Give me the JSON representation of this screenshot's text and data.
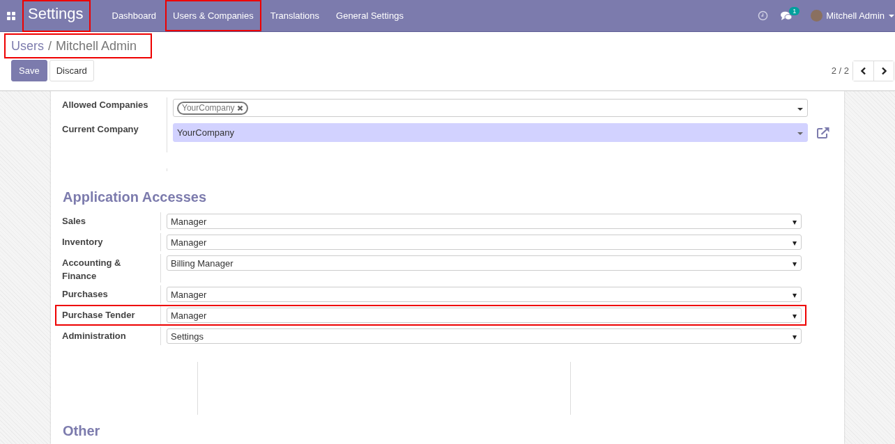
{
  "navbar": {
    "app_title": {
      "text": "Settings",
      "highlighted": true
    },
    "menu": [
      {
        "label": "Dashboard",
        "highlighted": false
      },
      {
        "label": "Users & Companies",
        "highlighted": true
      },
      {
        "label": "Translations",
        "highlighted": false
      },
      {
        "label": "General Settings",
        "highlighted": false
      }
    ],
    "messages_badge": "1",
    "user": "Mitchell Admin"
  },
  "breadcrumb": {
    "items": [
      "Users",
      "Mitchell Admin"
    ],
    "separator": "/",
    "highlighted": true
  },
  "buttons": {
    "save": "Save",
    "discard": "Discard"
  },
  "pager": {
    "text": "2 / 2"
  },
  "company_fields": {
    "allowed_label": "Allowed Companies",
    "allowed_tags": [
      "YourCompany"
    ],
    "current_label": "Current Company",
    "current_value": "YourCompany"
  },
  "application_accesses": {
    "title": "Application Accesses",
    "rows": [
      {
        "label": "Sales",
        "value": "Manager",
        "highlighted": false
      },
      {
        "label": "Inventory",
        "value": "Manager",
        "highlighted": false
      },
      {
        "label": "Accounting & Finance",
        "value": "Billing Manager",
        "highlighted": false
      },
      {
        "label": "Purchases",
        "value": "Manager",
        "highlighted": false
      },
      {
        "label": "Purchase Tender",
        "value": "Manager",
        "highlighted": true
      },
      {
        "label": "Administration",
        "value": "Settings",
        "highlighted": false
      }
    ]
  },
  "other": {
    "title": "Other"
  }
}
